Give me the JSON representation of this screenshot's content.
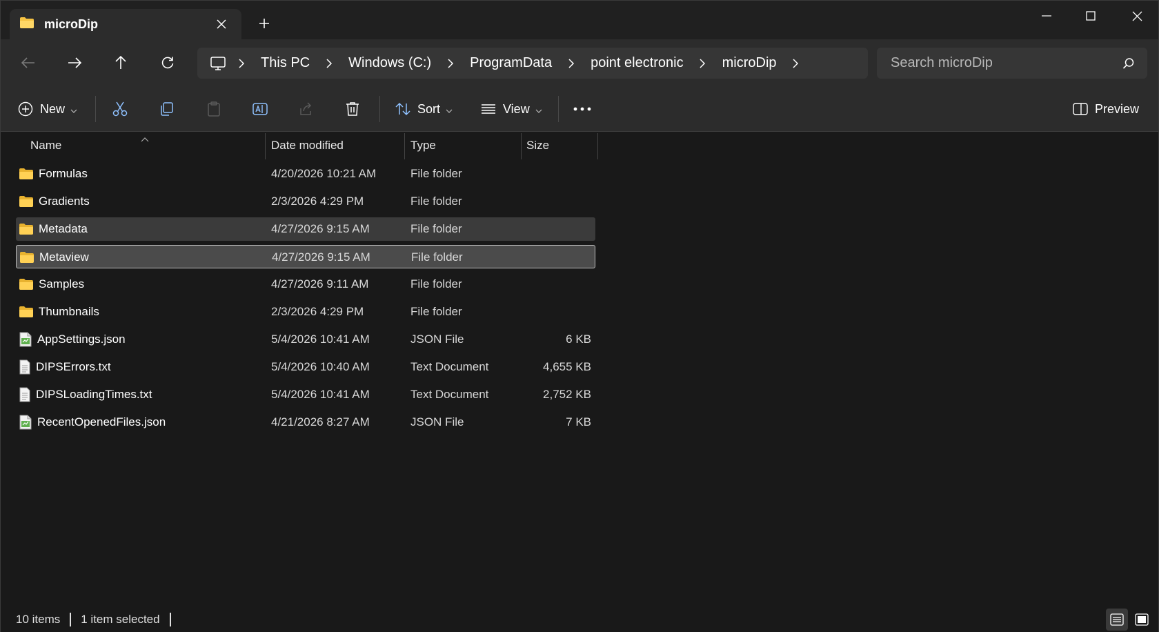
{
  "tab": {
    "title": "microDip",
    "icon": "folder-icon"
  },
  "window_controls": {
    "minimize": "minimize-icon",
    "maximize": "maximize-icon",
    "close": "close-icon"
  },
  "navigation": {
    "back": "back-arrow-icon",
    "forward": "forward-arrow-icon",
    "up": "up-arrow-icon",
    "refresh": "refresh-icon"
  },
  "breadcrumb": [
    "This PC",
    "Windows (C:)",
    "ProgramData",
    "point electronic",
    "microDip"
  ],
  "search": {
    "placeholder": "Search microDip"
  },
  "toolbar": {
    "new_label": "New",
    "sort_label": "Sort",
    "view_label": "View",
    "preview_label": "Preview"
  },
  "columns": {
    "name": "Name",
    "date": "Date modified",
    "type": "Type",
    "size": "Size"
  },
  "files": [
    {
      "name": "Formulas",
      "date": "4/20/2026 10:21 AM",
      "type": "File folder",
      "size": "",
      "kind": "folder"
    },
    {
      "name": "Gradients",
      "date": "2/3/2026 4:29 PM",
      "type": "File folder",
      "size": "",
      "kind": "folder"
    },
    {
      "name": "Metadata",
      "date": "4/27/2026 9:15 AM",
      "type": "File folder",
      "size": "",
      "kind": "folder"
    },
    {
      "name": "Metaview",
      "date": "4/27/2026 9:15 AM",
      "type": "File folder",
      "size": "",
      "kind": "folder"
    },
    {
      "name": "Samples",
      "date": "4/27/2026 9:11 AM",
      "type": "File folder",
      "size": "",
      "kind": "folder"
    },
    {
      "name": "Thumbnails",
      "date": "2/3/2026 4:29 PM",
      "type": "File folder",
      "size": "",
      "kind": "folder"
    },
    {
      "name": "AppSettings.json",
      "date": "5/4/2026 10:41 AM",
      "type": "JSON File",
      "size": "6 KB",
      "kind": "json"
    },
    {
      "name": "DIPSErrors.txt",
      "date": "5/4/2026 10:40 AM",
      "type": "Text Document",
      "size": "4,655 KB",
      "kind": "txt"
    },
    {
      "name": "DIPSLoadingTimes.txt",
      "date": "5/4/2026 10:41 AM",
      "type": "Text Document",
      "size": "2,752 KB",
      "kind": "txt"
    },
    {
      "name": "RecentOpenedFiles.json",
      "date": "4/21/2026 8:27 AM",
      "type": "JSON File",
      "size": "7 KB",
      "kind": "json"
    }
  ],
  "hover_row": 2,
  "selected_row": 3,
  "status": {
    "items": "10 items",
    "selected": "1 item selected"
  },
  "colors": {
    "folder": "#f6c343",
    "background": "#191919",
    "toolbar": "#2c2c2c"
  }
}
